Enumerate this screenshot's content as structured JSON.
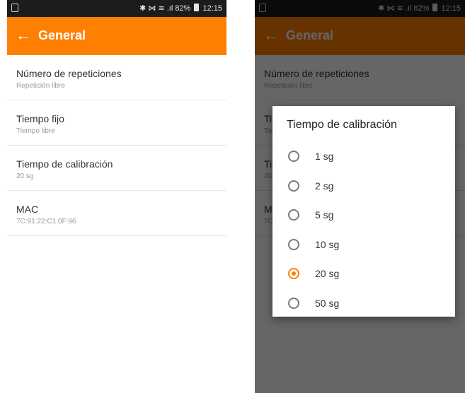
{
  "status_bar": {
    "right_text": "✱ ⋈ ≋ .ıl 82%",
    "time": "12:15"
  },
  "app_bar": {
    "back_icon": "←",
    "title": "General"
  },
  "settings": [
    {
      "title": "Número de repeticiones",
      "subtitle": "Repetición libre"
    },
    {
      "title": "Tiempo fijo",
      "subtitle": "Tiempo libre"
    },
    {
      "title": "Tiempo de calibración",
      "subtitle": "20 sg"
    },
    {
      "title": "MAC",
      "subtitle": "7C:91:22:C1:0F:96"
    }
  ],
  "dialog": {
    "title": "Tiempo de calibración",
    "options": [
      {
        "label": "1 sg",
        "selected": false
      },
      {
        "label": "2 sg",
        "selected": false
      },
      {
        "label": "5 sg",
        "selected": false
      },
      {
        "label": "10 sg",
        "selected": false
      },
      {
        "label": "20 sg",
        "selected": true
      },
      {
        "label": "50 sg",
        "selected": false
      }
    ]
  },
  "colors": {
    "accent": "#ff7f00",
    "status_bar": "#1c1c1c"
  }
}
